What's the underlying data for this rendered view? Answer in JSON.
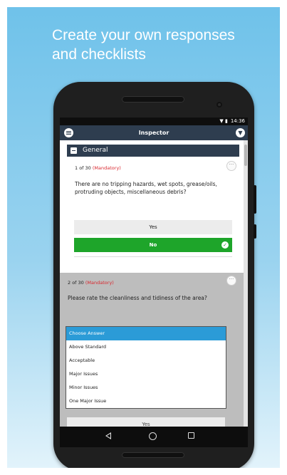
{
  "headline": {
    "line1": "Create your own responses",
    "line2": "and checklists"
  },
  "status_bar": {
    "time": "14:36",
    "icons": "▼ ▮"
  },
  "app_bar": {
    "title": "Inspector",
    "menu_icon": "list-icon",
    "filter_icon": "filter-icon"
  },
  "section": {
    "label": "General"
  },
  "questions": [
    {
      "number": "1 of 30",
      "mandatory": "(Mandatory)",
      "text": "There are no tripping hazards, wet spots, grease/oils, protruding objects, miscellaneous debris?",
      "options": [
        "Yes",
        "No"
      ],
      "selected": "No"
    },
    {
      "number": "2 of 30",
      "mandatory": "(Mandatory)",
      "text": "Please rate the cleanliness and tidiness of the area?"
    }
  ],
  "dropdown": {
    "options": [
      "Choose Answer",
      "Above Standard",
      "Acceptable",
      "Major Issues",
      "Minor Issues",
      "One Major Issue"
    ],
    "selected": "Choose Answer"
  },
  "partial_option": "Yes",
  "colors": {
    "appbar": "#2e3d4f",
    "mandatory": "#d9282f",
    "selected_answer": "#1ea52a",
    "dropdown_highlight": "#2b9bd7"
  }
}
